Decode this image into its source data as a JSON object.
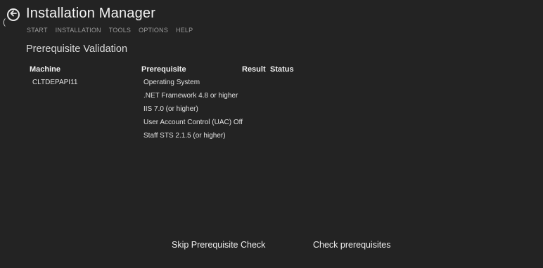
{
  "window": {
    "edge_glyph": "(",
    "title": "Installation Manager"
  },
  "icons": {
    "back": "arrow-left-circle-icon"
  },
  "menu": [
    "START",
    "INSTALLATION",
    "TOOLS",
    "OPTIONS",
    "HELP"
  ],
  "page": {
    "section_title": "Prerequisite Validation"
  },
  "table": {
    "headers": {
      "machine": "Machine",
      "prerequisite": "Prerequisite",
      "result": "Result",
      "status": "Status"
    },
    "machine": "CLTDEPAPI11",
    "prerequisites": [
      "Operating System",
      ".NET Framework 4.8 or higher",
      "IIS 7.0 (or higher)",
      "User Account Control (UAC) Off",
      "Staff STS 2.1.5 (or higher)"
    ]
  },
  "actions": {
    "skip_label": "Skip Prerequisite Check",
    "check_label": "Check prerequisites"
  },
  "colors": {
    "background": "#232323",
    "text": "#e6e6e6",
    "menu_text": "#9a9a9a"
  }
}
